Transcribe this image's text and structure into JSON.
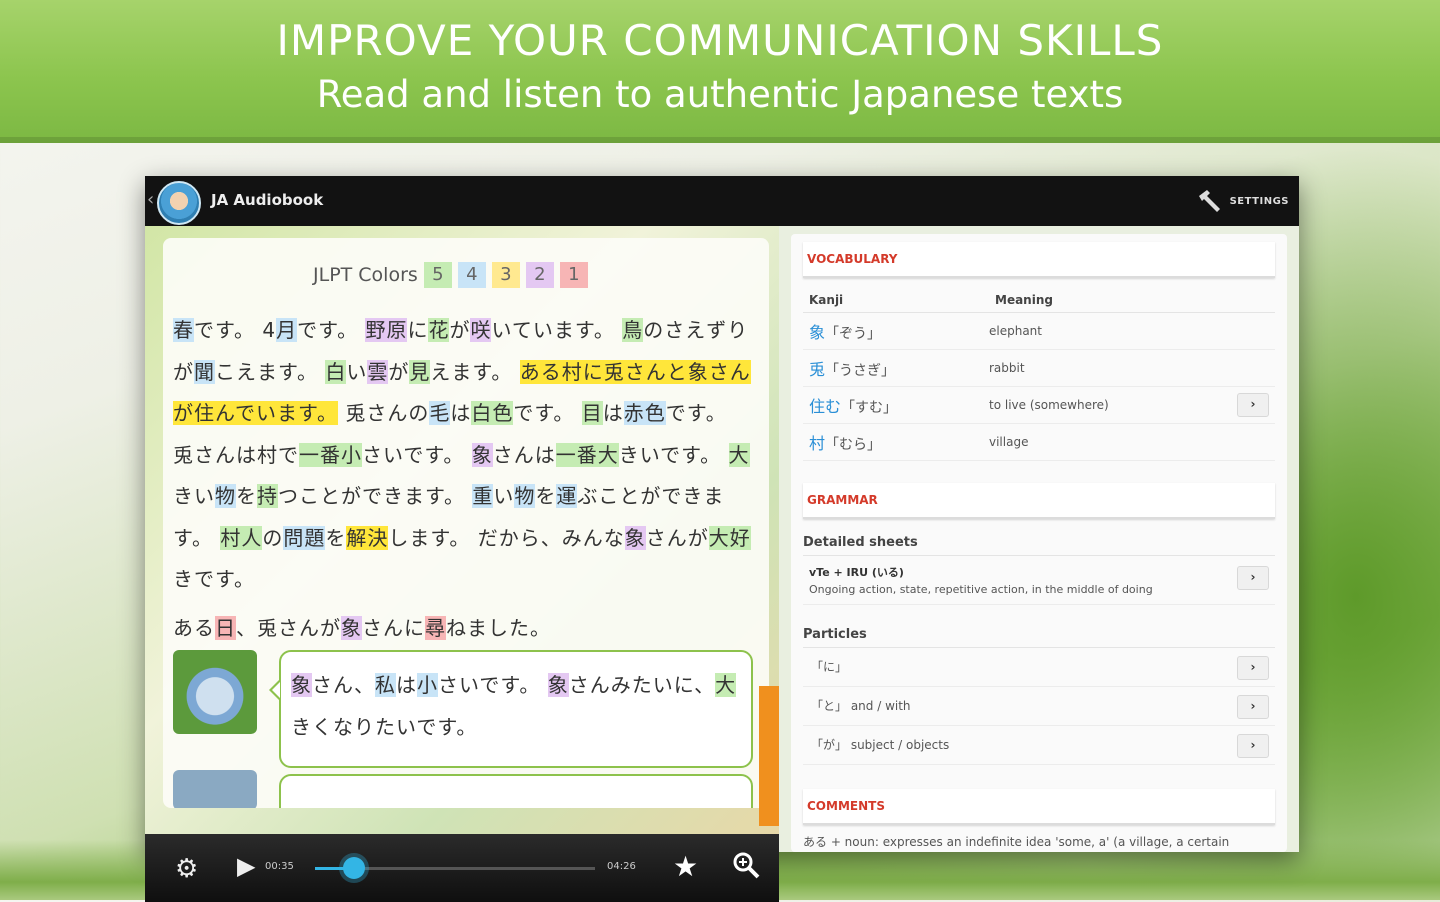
{
  "banner": {
    "title": "IMPROVE YOUR COMMUNICATION SKILLS",
    "subtitle": "Read and listen to authentic Japanese texts"
  },
  "actionbar": {
    "back_glyph": "‹",
    "app_title": "JA Audiobook",
    "settings_label": "SETTINGS",
    "settings_icon": "hammer-icon"
  },
  "reader": {
    "jlpt_label": "JLPT Colors",
    "jlpt_levels": [
      "5",
      "4",
      "3",
      "2",
      "1"
    ],
    "jlpt_colors": [
      "#c5ecb3",
      "#c8e4f7",
      "#ffe990",
      "#e4c8f2",
      "#f7b5b5"
    ],
    "paragraph": [
      {
        "t": "春",
        "c": "b"
      },
      {
        "t": "です。 4"
      },
      {
        "t": "月",
        "c": "b"
      },
      {
        "t": "です。 "
      },
      {
        "t": "野原",
        "c": "p"
      },
      {
        "t": "に"
      },
      {
        "t": "花",
        "c": "g"
      },
      {
        "t": "が"
      },
      {
        "t": "咲",
        "c": "p"
      },
      {
        "t": "いています。 "
      },
      {
        "t": "鳥",
        "c": "g"
      },
      {
        "t": "のさえずりが"
      },
      {
        "t": "聞",
        "c": "b"
      },
      {
        "t": "こえます。 "
      },
      {
        "t": "白",
        "c": "g"
      },
      {
        "t": "い"
      },
      {
        "t": "雲",
        "c": "p"
      },
      {
        "t": "が"
      },
      {
        "t": "見",
        "c": "g"
      },
      {
        "t": "えます。 "
      },
      {
        "t": "ある村に兎さんと象さんが住んでいます。",
        "c": "y"
      },
      {
        "t": " 兎さんの"
      },
      {
        "t": "毛",
        "c": "b"
      },
      {
        "t": "は"
      },
      {
        "t": "白色",
        "c": "g"
      },
      {
        "t": "です。 "
      },
      {
        "t": "目",
        "c": "g"
      },
      {
        "t": "は"
      },
      {
        "t": "赤色",
        "c": "b"
      },
      {
        "t": "です。 兎さんは村で"
      },
      {
        "t": "一番小",
        "c": "g"
      },
      {
        "t": "さいです。 "
      },
      {
        "t": "象",
        "c": "p"
      },
      {
        "t": "さんは"
      },
      {
        "t": "一番大",
        "c": "g"
      },
      {
        "t": "きいです。 "
      },
      {
        "t": "大",
        "c": "g"
      },
      {
        "t": "きい"
      },
      {
        "t": "物",
        "c": "b"
      },
      {
        "t": "を"
      },
      {
        "t": "持",
        "c": "g"
      },
      {
        "t": "つことができます。 "
      },
      {
        "t": "重",
        "c": "b"
      },
      {
        "t": "い"
      },
      {
        "t": "物",
        "c": "b"
      },
      {
        "t": "を"
      },
      {
        "t": "運",
        "c": "b"
      },
      {
        "t": "ぶことができます。 "
      },
      {
        "t": "村人",
        "c": "g"
      },
      {
        "t": "の"
      },
      {
        "t": "問題",
        "c": "b"
      },
      {
        "t": "を"
      },
      {
        "t": "解決",
        "c": "y"
      },
      {
        "t": "します。 だから、みんな"
      },
      {
        "t": "象",
        "c": "p"
      },
      {
        "t": "さんが"
      },
      {
        "t": "大好",
        "c": "g"
      },
      {
        "t": "きです。"
      }
    ],
    "line2": [
      {
        "t": "ある"
      },
      {
        "t": "日",
        "c": "r"
      },
      {
        "t": "、兎さんが"
      },
      {
        "t": "象",
        "c": "p"
      },
      {
        "t": "さんに"
      },
      {
        "t": "尋",
        "c": "r"
      },
      {
        "t": "ねました。"
      }
    ],
    "bubble": [
      {
        "t": "象",
        "c": "p"
      },
      {
        "t": "さん、"
      },
      {
        "t": "私",
        "c": "b"
      },
      {
        "t": "は"
      },
      {
        "t": "小",
        "c": "b"
      },
      {
        "t": "さいです。 "
      },
      {
        "t": "象",
        "c": "p"
      },
      {
        "t": "さんみたいに、"
      },
      {
        "t": "大",
        "c": "g"
      },
      {
        "t": "きくなりたいです。"
      }
    ]
  },
  "player": {
    "settings_icon": "gear-icon",
    "play_icon": "play-icon",
    "elapsed": "00:35",
    "total": "04:26",
    "progress": 0.14,
    "favorite_icon": "star-icon",
    "zoom_icon": "zoom-icon"
  },
  "sidebar": {
    "vocabulary_title": "VOCABULARY",
    "vocab_headers": {
      "kanji": "Kanji",
      "meaning": "Meaning"
    },
    "vocab": [
      {
        "kanji": "象",
        "reading": "「ぞう」",
        "meaning": "elephant",
        "has_detail": false
      },
      {
        "kanji": "兎",
        "reading": "「うさぎ」",
        "meaning": "rabbit",
        "has_detail": false
      },
      {
        "kanji": "住む",
        "reading": "「すむ」",
        "meaning": "to live (somewhere)",
        "has_detail": true
      },
      {
        "kanji": "村",
        "reading": "「むら」",
        "meaning": "village",
        "has_detail": false
      }
    ],
    "grammar_title": "GRAMMAR",
    "detailed_sheets_label": "Detailed sheets",
    "grammar_items": [
      {
        "title": "vTe + IRU (いる)",
        "desc": "Ongoing action, state, repetitive action, in the middle of doing"
      }
    ],
    "particles_label": "Particles",
    "particles": [
      "「に」",
      "「と」 and / with",
      "「が」 subject / objects"
    ],
    "comments_title": "COMMENTS",
    "comment_text": "ある + noun: expresses an indefinite idea 'some, a' (a village, a certain"
  }
}
